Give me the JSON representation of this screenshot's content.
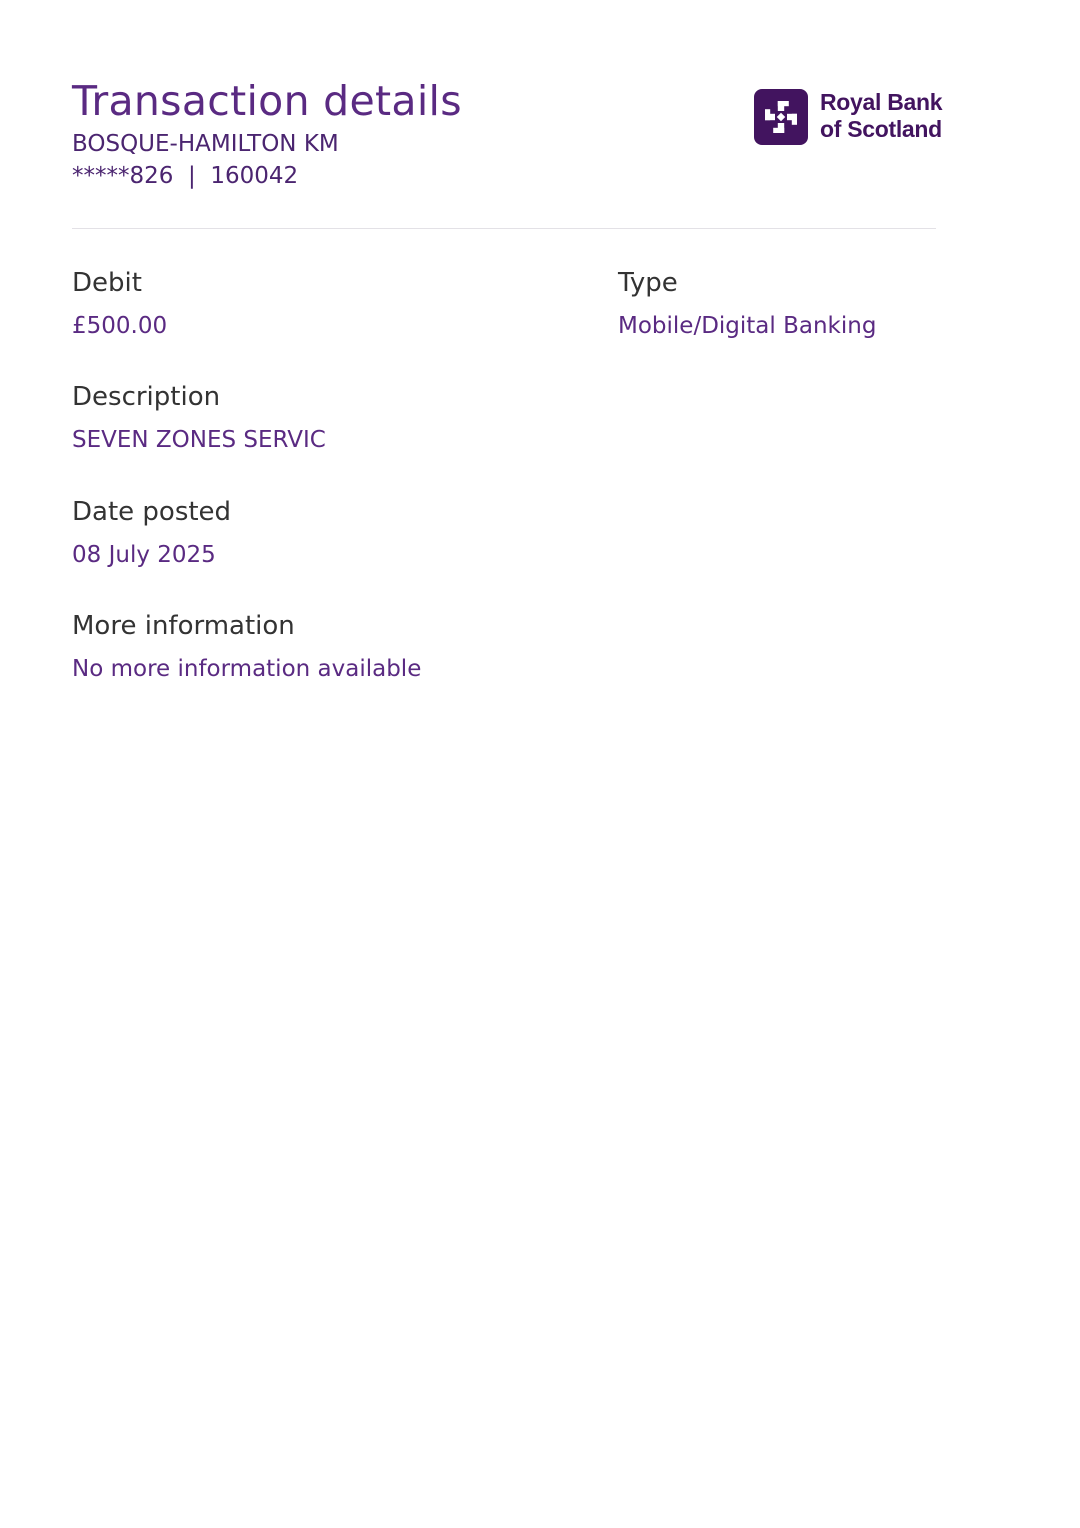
{
  "header": {
    "title": "Transaction details",
    "account_name": "BOSQUE-HAMILTON KM",
    "account_numbers": "*****826  |  160042"
  },
  "logo": {
    "icon": "rbs-daisy-wheel-icon",
    "line1": "Royal Bank",
    "line2": "of Scotland",
    "brand_color": "#42145f"
  },
  "fields": {
    "debit": {
      "label": "Debit",
      "value": "£500.00"
    },
    "type": {
      "label": "Type",
      "value": "Mobile/Digital Banking"
    },
    "description": {
      "label": "Description",
      "value": "SEVEN ZONES SERVIC"
    },
    "date_posted": {
      "label": "Date posted",
      "value": "08 July 2025"
    },
    "more_information": {
      "label": "More information",
      "value": "No more information available"
    }
  },
  "colors": {
    "accent": "#5a2a82",
    "label_text": "#333333",
    "divider": "#e3e1e6"
  }
}
